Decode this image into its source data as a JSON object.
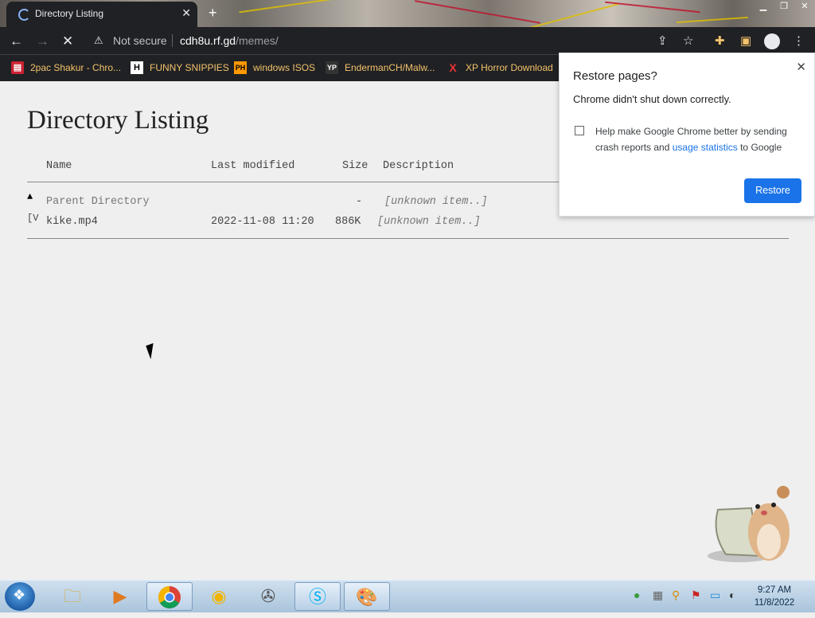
{
  "browser": {
    "tab": {
      "title": "Directory Listing"
    },
    "omnibox": {
      "security_label": "Not secure",
      "host": "cdh8u.rf.gd",
      "path": "/memes/"
    },
    "bookmarks": [
      {
        "label": "2pac Shakur - Chro...",
        "icon": "music-folder-icon"
      },
      {
        "label": "FUNNY SNIPPIES",
        "icon": "H"
      },
      {
        "label": "windows ISOS",
        "icon": "PH"
      },
      {
        "label": "EndermanCH/Malw...",
        "icon": "YP"
      },
      {
        "label": "XP Horror Download",
        "icon": "X"
      }
    ]
  },
  "page": {
    "title": "Directory Listing",
    "columns": {
      "name": "Name",
      "modified": "Last modified",
      "size": "Size",
      "description": "Description"
    },
    "rows": [
      {
        "icon": "▲",
        "name": "Parent Directory",
        "modified": "",
        "size": "-",
        "description": "[unknown item..]"
      },
      {
        "icon": "[V",
        "name": "kike.mp4",
        "modified": "2022-11-08 11:20",
        "size": "886K",
        "description": "[unknown item..]"
      }
    ]
  },
  "popup": {
    "title": "Restore pages?",
    "message": "Chrome didn't shut down correctly.",
    "help_prefix": "Help make Google Chrome better by sending crash reports and ",
    "help_link": "usage statistics",
    "help_suffix": " to Google",
    "button": "Restore"
  },
  "taskbar": {
    "time": "9:27 AM",
    "date": "11/8/2022"
  },
  "colors": {
    "accent": "#1a73e8",
    "toolbar": "#202124",
    "page_bg": "#efefef"
  }
}
